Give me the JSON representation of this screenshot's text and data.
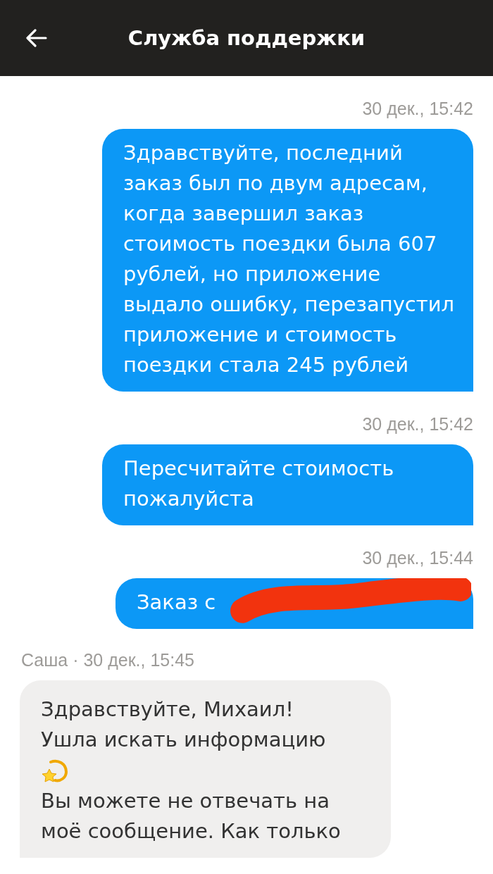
{
  "header": {
    "title": "Служба поддержки"
  },
  "messages": [
    {
      "kind": "out",
      "time": "30 дек., 15:42",
      "parts": [
        {
          "kind": "text",
          "text": "Здравствуйте, последний заказ был по двум адресам, когда завершил заказ стоимость поездки была 607 рублей, но приложение выдало ошибку, перезапустил приложение и стоимость поездки стала 245 рублей"
        }
      ]
    },
    {
      "kind": "out",
      "time": "30 дек., 15:42",
      "parts": [
        {
          "kind": "text",
          "text": "Пересчитайте стоимость пожалуйста"
        }
      ]
    },
    {
      "kind": "out",
      "time": "30 дек., 15:44",
      "redacted": true,
      "parts": [
        {
          "kind": "text",
          "text": "Заказ с"
        }
      ]
    },
    {
      "kind": "in",
      "time": "Саша · 30 дек., 15:45",
      "parts": [
        {
          "kind": "text",
          "text": "Здравствуйте, Михаил!"
        },
        {
          "kind": "text",
          "text": "Ушла искать информацию"
        },
        {
          "kind": "emoji"
        },
        {
          "kind": "text",
          "text": "Вы можете не отвечать на моё сообщение. Как только"
        }
      ]
    }
  ]
}
